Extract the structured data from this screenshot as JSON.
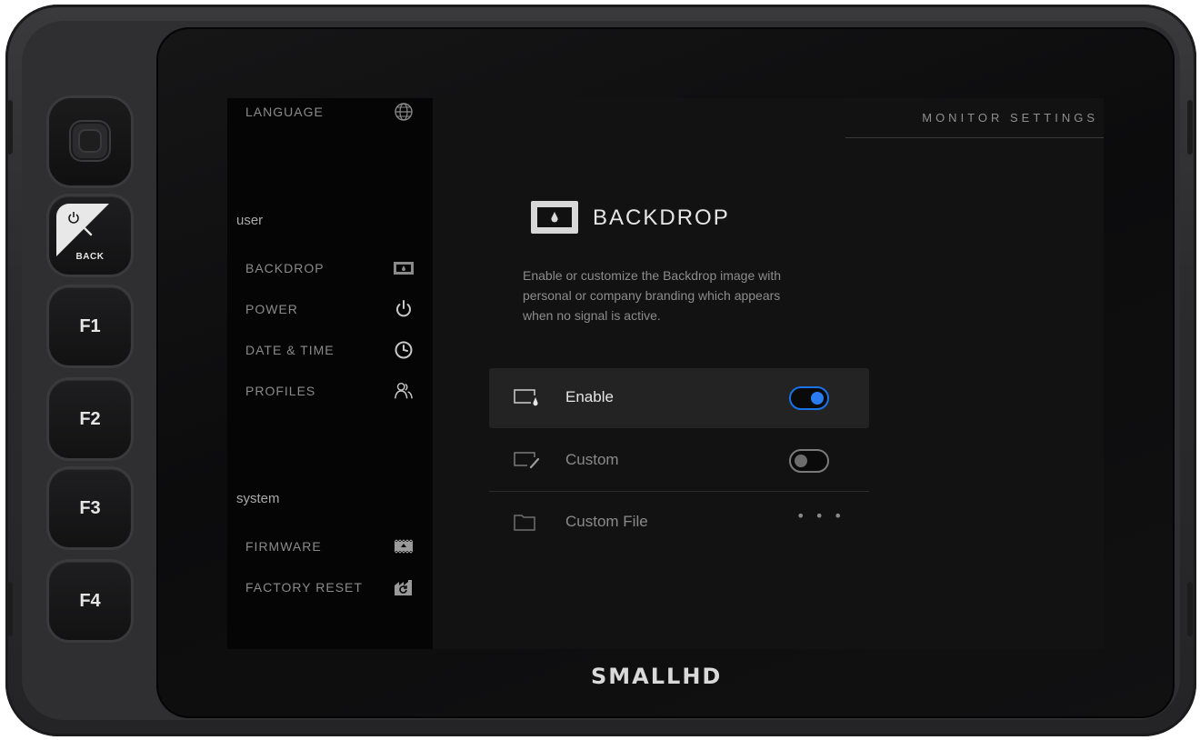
{
  "hardware": {
    "back_label": "BACK",
    "buttons": [
      "F1",
      "F2",
      "F3",
      "F4"
    ],
    "brand": "SMALLHD"
  },
  "header": {
    "title": "MONITOR SETTINGS"
  },
  "sidebar": {
    "top_items": [
      {
        "label": "LANGUAGE",
        "icon": "globe-icon"
      }
    ],
    "sections": [
      {
        "title": "user",
        "items": [
          {
            "label": "BACKDROP",
            "icon": "backdrop-icon"
          },
          {
            "label": "POWER",
            "icon": "power-icon"
          },
          {
            "label": "DATE & TIME",
            "icon": "clock-icon"
          },
          {
            "label": "PROFILES",
            "icon": "profiles-icon"
          }
        ]
      },
      {
        "title": "system",
        "items": [
          {
            "label": "FIRMWARE",
            "icon": "firmware-icon"
          },
          {
            "label": "FACTORY RESET",
            "icon": "factory-reset-icon"
          }
        ]
      }
    ]
  },
  "main": {
    "title": "BACKDROP",
    "icon": "backdrop-icon",
    "description": "Enable or customize the Backdrop image with personal or company branding which appears when no signal is active.",
    "settings": [
      {
        "label": "Enable",
        "icon": "backdrop-enable-icon",
        "control": "toggle",
        "value": true,
        "selected": true
      },
      {
        "label": "Custom",
        "icon": "edit-screen-icon",
        "control": "toggle",
        "value": false,
        "selected": false
      },
      {
        "label": "Custom File",
        "icon": "folder-icon",
        "control": "more",
        "value": "• • •",
        "selected": false
      }
    ]
  },
  "colors": {
    "accent": "#1a73e8",
    "background": "#121212",
    "sidebar": "#050505",
    "selected_row": "#232323"
  }
}
